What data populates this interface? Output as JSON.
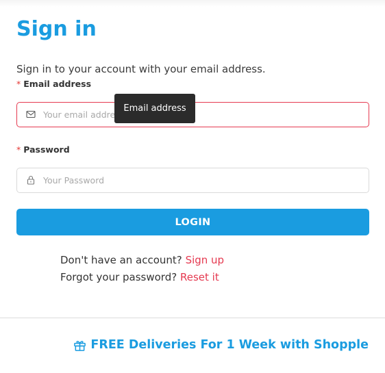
{
  "title": "Sign in",
  "subtitle": "Sign in to your account with your email address.",
  "email": {
    "required_mark": "*",
    "label": "Email address",
    "placeholder": "Your email address",
    "icon": "mail-icon",
    "tooltip": "Email address"
  },
  "password": {
    "required_mark": "*",
    "label": "Password",
    "placeholder": "Your Password",
    "icon": "lock-icon"
  },
  "login_button": "LOGIN",
  "links": {
    "no_account_text": "Don't have an account?",
    "signup_label": "Sign up",
    "forgot_text": "Forgot your password?",
    "reset_label": "Reset it"
  },
  "promo": {
    "icon": "gift-icon",
    "text": "FREE Deliveries For 1 Week with Shopple"
  },
  "colors": {
    "accent": "#1a9ce0",
    "link": "#e53950",
    "error_border": "#e53950"
  }
}
